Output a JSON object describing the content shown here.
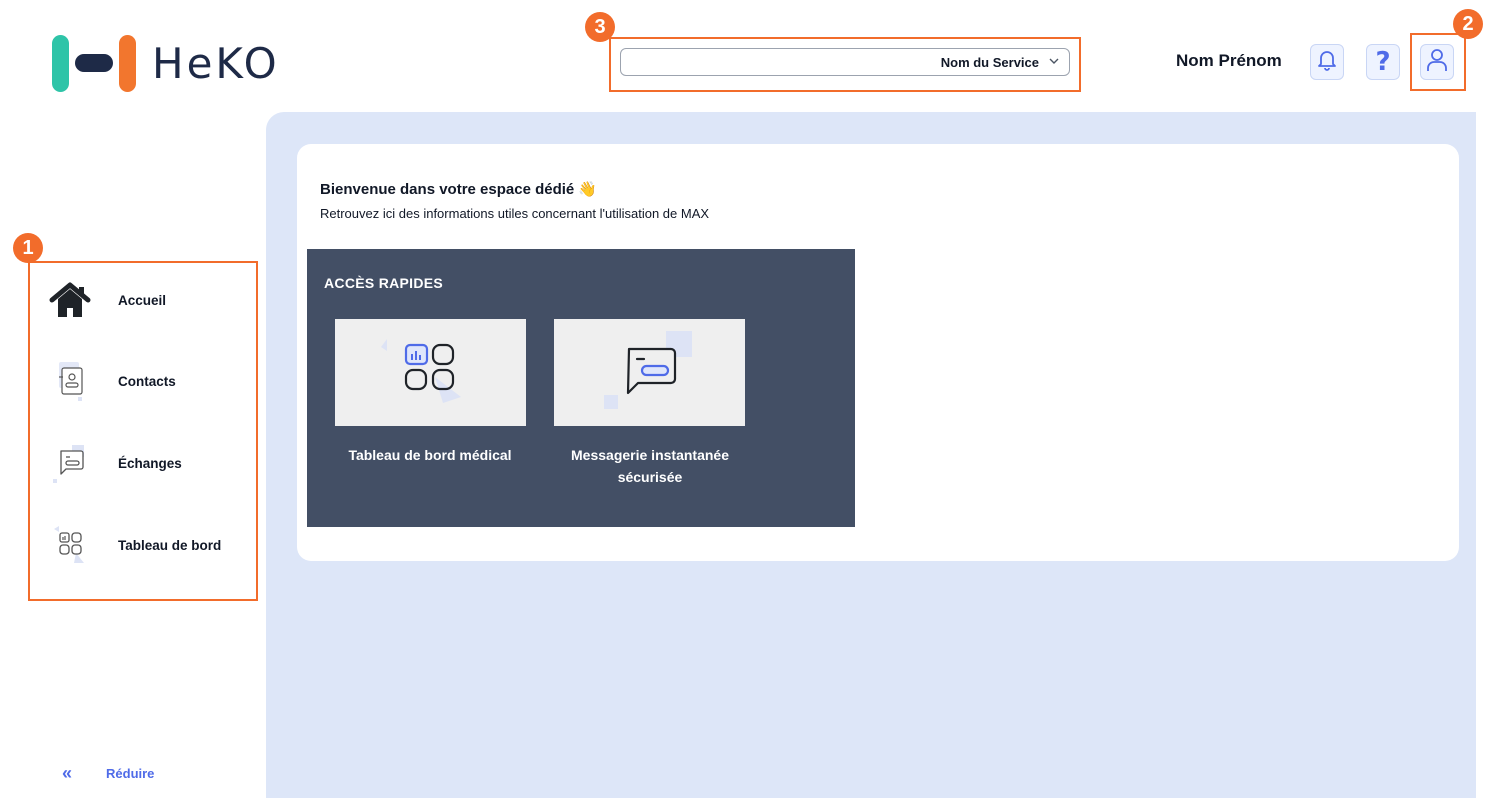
{
  "app": {
    "logo_text": "HeKO",
    "colors": {
      "accent": "#f26c2b",
      "teal": "#2ec4a8",
      "navy": "#1e2a47",
      "link": "#4f6be8",
      "panel": "#434f65",
      "main_bg": "#dde6f8"
    }
  },
  "header": {
    "service_select": {
      "value": "Nom du Service",
      "icon": "chevron-down-icon"
    },
    "user_name": "Nom Prénom",
    "buttons": [
      {
        "icon": "bell-icon"
      },
      {
        "icon": "help-icon"
      },
      {
        "icon": "user-icon"
      }
    ]
  },
  "annotations": {
    "badge_1": "1",
    "badge_2": "2",
    "badge_3": "3"
  },
  "sidebar": {
    "items": [
      {
        "label": "Accueil",
        "icon": "home-icon"
      },
      {
        "label": "Contacts",
        "icon": "contact-card-icon"
      },
      {
        "label": "Échanges",
        "icon": "chat-icon"
      },
      {
        "label": "Tableau de bord",
        "icon": "dashboard-icon"
      }
    ],
    "collapse": {
      "label": "Réduire",
      "icon": "«"
    }
  },
  "main": {
    "welcome_title": "Bienvenue dans votre espace dédié 👋",
    "welcome_subtitle": "Retrouvez ici des informations utiles concernant l'utilisation de MAX",
    "quick_access": {
      "title": "ACCÈS RAPIDES",
      "tiles": [
        {
          "label": "Tableau de bord médical",
          "icon": "dashboard-icon"
        },
        {
          "label": "Messagerie instantanée sécurisée",
          "icon": "chat-icon"
        }
      ]
    }
  }
}
